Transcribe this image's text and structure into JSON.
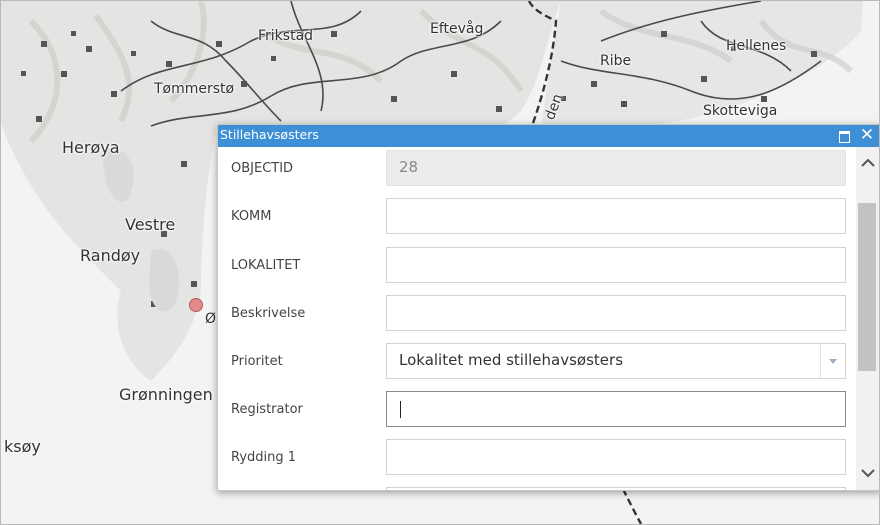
{
  "map": {
    "places": [
      {
        "name": "Frikstad",
        "size": "sm"
      },
      {
        "name": "Eftevåg",
        "size": "sm"
      },
      {
        "name": "Hellenes",
        "size": "sm"
      },
      {
        "name": "Ribe",
        "size": "sm"
      },
      {
        "name": "Tømmerstø",
        "size": "sm"
      },
      {
        "name": "Skotteviga",
        "size": "sm"
      },
      {
        "name": "Herøya",
        "size": "lg"
      },
      {
        "name": "Vestre",
        "size": "lg"
      },
      {
        "name": "Randøy",
        "size": "lg"
      },
      {
        "name": "Grønningen",
        "size": "lg"
      },
      {
        "name": "ksøy",
        "size": "lg"
      },
      {
        "name": "den",
        "size": "sm"
      },
      {
        "name": "Ø",
        "size": "sm"
      }
    ],
    "marker_color": "#e58a8a"
  },
  "popup": {
    "title": "Stillehavsøsters",
    "maximize_icon": "maximize-icon",
    "close_icon": "close-icon",
    "close_glyph": "✕",
    "fields": [
      {
        "label": "OBJECTID",
        "value": "28",
        "state": "readonly"
      },
      {
        "label": "KOMM",
        "value": ""
      },
      {
        "label": "LOKALITET",
        "value": ""
      },
      {
        "label": "Beskrivelse",
        "value": ""
      },
      {
        "label": "Prioritet",
        "value": "Lokalitet med stillehavsøsters",
        "state": "dropdown"
      },
      {
        "label": "Registrator",
        "value": "",
        "state": "active"
      },
      {
        "label": "Rydding 1",
        "value": ""
      }
    ],
    "accent_color": "#3d8fd6"
  }
}
